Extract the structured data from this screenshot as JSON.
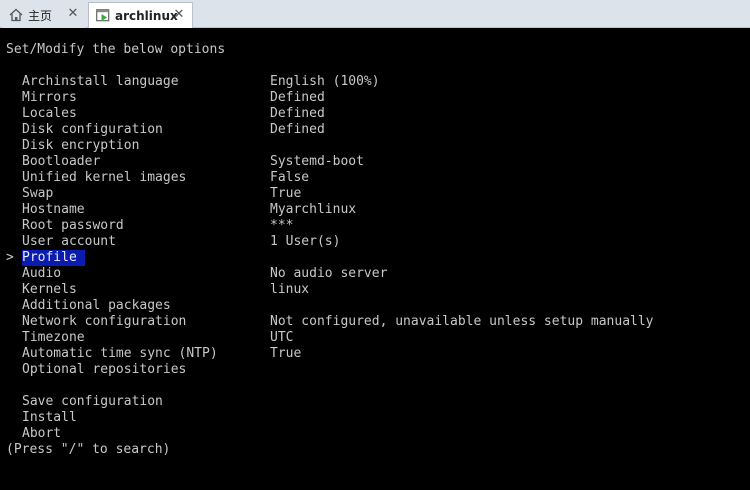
{
  "tabs": [
    {
      "label": "主页",
      "icon": "home-icon"
    },
    {
      "label": "archlinux",
      "icon": "vm-icon"
    }
  ],
  "terminal": {
    "heading": "Set/Modify the below options",
    "cursor_glyph": ">",
    "options": [
      {
        "label": "Archinstall language",
        "value": "English (100%)"
      },
      {
        "label": "Mirrors",
        "value": "Defined"
      },
      {
        "label": "Locales",
        "value": "Defined"
      },
      {
        "label": "Disk configuration",
        "value": "Defined"
      },
      {
        "label": "Disk encryption",
        "value": ""
      },
      {
        "label": "Bootloader",
        "value": "Systemd-boot"
      },
      {
        "label": "Unified kernel images",
        "value": "False"
      },
      {
        "label": "Swap",
        "value": "True"
      },
      {
        "label": "Hostname",
        "value": "Myarchlinux"
      },
      {
        "label": "Root password",
        "value": "***"
      },
      {
        "label": "User account",
        "value": "1 User(s)"
      },
      {
        "label": "Profile",
        "value": "",
        "selected": true
      },
      {
        "label": "Audio",
        "value": "No audio server"
      },
      {
        "label": "Kernels",
        "value": "linux"
      },
      {
        "label": "Additional packages",
        "value": ""
      },
      {
        "label": "Network configuration",
        "value": "Not configured, unavailable unless setup manually"
      },
      {
        "label": "Timezone",
        "value": "UTC"
      },
      {
        "label": "Automatic time sync (NTP)",
        "value": "True"
      },
      {
        "label": "Optional repositories",
        "value": ""
      },
      {
        "label": "",
        "value": ""
      },
      {
        "label": "Save configuration",
        "value": ""
      },
      {
        "label": "Install",
        "value": ""
      },
      {
        "label": "Abort",
        "value": ""
      }
    ],
    "hint": "(Press \"/\" to search)"
  },
  "colors": {
    "selection_bg": "#0a1bb0",
    "terminal_bg": "#000000",
    "terminal_fg": "#c8c8c8"
  }
}
